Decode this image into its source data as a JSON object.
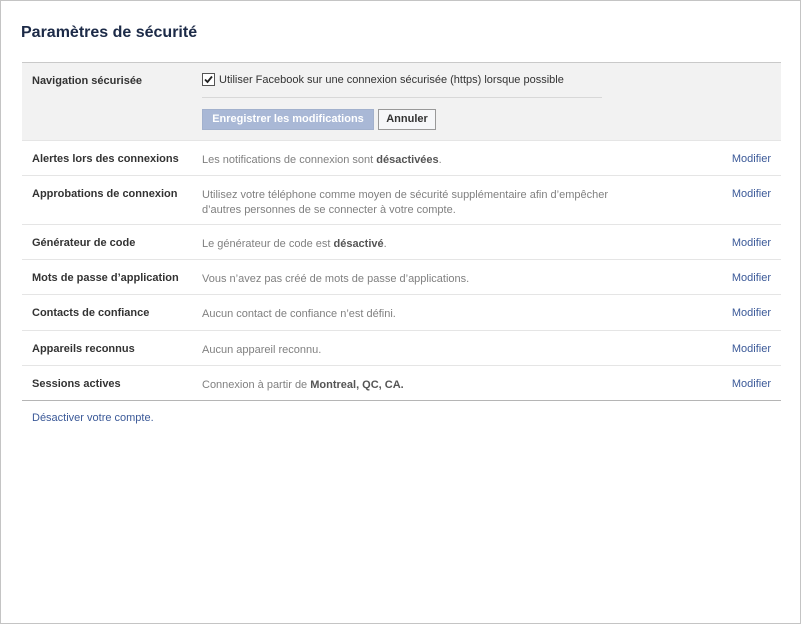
{
  "page": {
    "title": "Paramètres de sécurité"
  },
  "secure_browsing": {
    "label": "Navigation sécurisée",
    "checkbox_checked": true,
    "checkbox_label": "Utiliser Facebook sur une connexion sécurisée (https) lorsque possible",
    "save_button": "Enregistrer les modifications",
    "cancel_button": "Annuler"
  },
  "rows": [
    {
      "label": "Alertes lors des connexions",
      "desc_pre": "Les notifications de connexion sont ",
      "desc_bold": "désactivées",
      "desc_post": ".",
      "edit": "Modifier"
    },
    {
      "label": "Approbations de connexion",
      "desc_pre": "Utilisez votre téléphone comme moyen de sécurité supplémentaire afin d’empêcher d’autres personnes de se connecter à votre compte.",
      "desc_bold": "",
      "desc_post": "",
      "edit": "Modifier"
    },
    {
      "label": "Générateur de code",
      "desc_pre": "Le générateur de code est ",
      "desc_bold": "désactivé",
      "desc_post": ".",
      "edit": "Modifier"
    },
    {
      "label": "Mots de passe d’application",
      "desc_pre": "Vous n’avez pas créé de mots de passe d’applications.",
      "desc_bold": "",
      "desc_post": "",
      "edit": "Modifier"
    },
    {
      "label": "Contacts de confiance",
      "desc_pre": "Aucun contact de confiance n’est défini.",
      "desc_bold": "",
      "desc_post": "",
      "edit": "Modifier"
    },
    {
      "label": "Appareils reconnus",
      "desc_pre": "Aucun appareil reconnu.",
      "desc_bold": "",
      "desc_post": "",
      "edit": "Modifier"
    },
    {
      "label": "Sessions actives",
      "desc_pre": "Connexion à partir de ",
      "desc_bold": "Montreal, QC, CA.",
      "desc_post": "",
      "edit": "Modifier"
    }
  ],
  "footer": {
    "deactivate_link": "Désactiver votre compte."
  },
  "colors": {
    "link": "#3b5998",
    "title": "#1c2a47",
    "expanded_bg": "#f2f2f2",
    "save_button_bg": "#a9b8d6"
  },
  "icons": {
    "checkbox": "checkmark-icon"
  }
}
